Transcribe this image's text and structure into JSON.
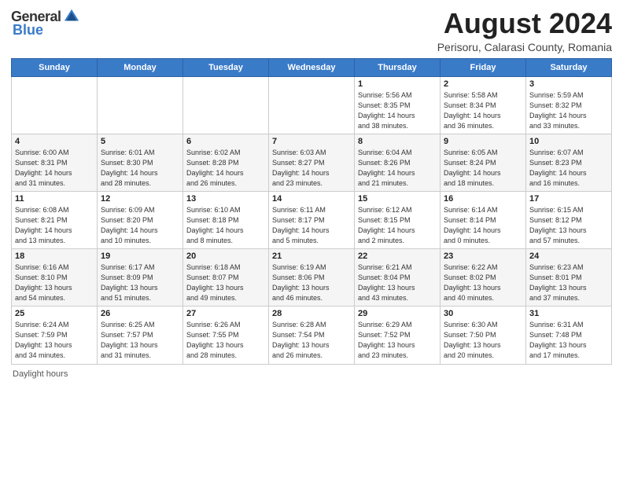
{
  "logo": {
    "general": "General",
    "blue": "Blue"
  },
  "header": {
    "month": "August 2024",
    "location": "Perisoru, Calarasi County, Romania"
  },
  "weekdays": [
    "Sunday",
    "Monday",
    "Tuesday",
    "Wednesday",
    "Thursday",
    "Friday",
    "Saturday"
  ],
  "footer": {
    "label": "Daylight hours"
  },
  "weeks": [
    [
      {
        "day": "",
        "info": ""
      },
      {
        "day": "",
        "info": ""
      },
      {
        "day": "",
        "info": ""
      },
      {
        "day": "",
        "info": ""
      },
      {
        "day": "1",
        "info": "Sunrise: 5:56 AM\nSunset: 8:35 PM\nDaylight: 14 hours\nand 38 minutes."
      },
      {
        "day": "2",
        "info": "Sunrise: 5:58 AM\nSunset: 8:34 PM\nDaylight: 14 hours\nand 36 minutes."
      },
      {
        "day": "3",
        "info": "Sunrise: 5:59 AM\nSunset: 8:32 PM\nDaylight: 14 hours\nand 33 minutes."
      }
    ],
    [
      {
        "day": "4",
        "info": "Sunrise: 6:00 AM\nSunset: 8:31 PM\nDaylight: 14 hours\nand 31 minutes."
      },
      {
        "day": "5",
        "info": "Sunrise: 6:01 AM\nSunset: 8:30 PM\nDaylight: 14 hours\nand 28 minutes."
      },
      {
        "day": "6",
        "info": "Sunrise: 6:02 AM\nSunset: 8:28 PM\nDaylight: 14 hours\nand 26 minutes."
      },
      {
        "day": "7",
        "info": "Sunrise: 6:03 AM\nSunset: 8:27 PM\nDaylight: 14 hours\nand 23 minutes."
      },
      {
        "day": "8",
        "info": "Sunrise: 6:04 AM\nSunset: 8:26 PM\nDaylight: 14 hours\nand 21 minutes."
      },
      {
        "day": "9",
        "info": "Sunrise: 6:05 AM\nSunset: 8:24 PM\nDaylight: 14 hours\nand 18 minutes."
      },
      {
        "day": "10",
        "info": "Sunrise: 6:07 AM\nSunset: 8:23 PM\nDaylight: 14 hours\nand 16 minutes."
      }
    ],
    [
      {
        "day": "11",
        "info": "Sunrise: 6:08 AM\nSunset: 8:21 PM\nDaylight: 14 hours\nand 13 minutes."
      },
      {
        "day": "12",
        "info": "Sunrise: 6:09 AM\nSunset: 8:20 PM\nDaylight: 14 hours\nand 10 minutes."
      },
      {
        "day": "13",
        "info": "Sunrise: 6:10 AM\nSunset: 8:18 PM\nDaylight: 14 hours\nand 8 minutes."
      },
      {
        "day": "14",
        "info": "Sunrise: 6:11 AM\nSunset: 8:17 PM\nDaylight: 14 hours\nand 5 minutes."
      },
      {
        "day": "15",
        "info": "Sunrise: 6:12 AM\nSunset: 8:15 PM\nDaylight: 14 hours\nand 2 minutes."
      },
      {
        "day": "16",
        "info": "Sunrise: 6:14 AM\nSunset: 8:14 PM\nDaylight: 14 hours\nand 0 minutes."
      },
      {
        "day": "17",
        "info": "Sunrise: 6:15 AM\nSunset: 8:12 PM\nDaylight: 13 hours\nand 57 minutes."
      }
    ],
    [
      {
        "day": "18",
        "info": "Sunrise: 6:16 AM\nSunset: 8:10 PM\nDaylight: 13 hours\nand 54 minutes."
      },
      {
        "day": "19",
        "info": "Sunrise: 6:17 AM\nSunset: 8:09 PM\nDaylight: 13 hours\nand 51 minutes."
      },
      {
        "day": "20",
        "info": "Sunrise: 6:18 AM\nSunset: 8:07 PM\nDaylight: 13 hours\nand 49 minutes."
      },
      {
        "day": "21",
        "info": "Sunrise: 6:19 AM\nSunset: 8:06 PM\nDaylight: 13 hours\nand 46 minutes."
      },
      {
        "day": "22",
        "info": "Sunrise: 6:21 AM\nSunset: 8:04 PM\nDaylight: 13 hours\nand 43 minutes."
      },
      {
        "day": "23",
        "info": "Sunrise: 6:22 AM\nSunset: 8:02 PM\nDaylight: 13 hours\nand 40 minutes."
      },
      {
        "day": "24",
        "info": "Sunrise: 6:23 AM\nSunset: 8:01 PM\nDaylight: 13 hours\nand 37 minutes."
      }
    ],
    [
      {
        "day": "25",
        "info": "Sunrise: 6:24 AM\nSunset: 7:59 PM\nDaylight: 13 hours\nand 34 minutes."
      },
      {
        "day": "26",
        "info": "Sunrise: 6:25 AM\nSunset: 7:57 PM\nDaylight: 13 hours\nand 31 minutes."
      },
      {
        "day": "27",
        "info": "Sunrise: 6:26 AM\nSunset: 7:55 PM\nDaylight: 13 hours\nand 28 minutes."
      },
      {
        "day": "28",
        "info": "Sunrise: 6:28 AM\nSunset: 7:54 PM\nDaylight: 13 hours\nand 26 minutes."
      },
      {
        "day": "29",
        "info": "Sunrise: 6:29 AM\nSunset: 7:52 PM\nDaylight: 13 hours\nand 23 minutes."
      },
      {
        "day": "30",
        "info": "Sunrise: 6:30 AM\nSunset: 7:50 PM\nDaylight: 13 hours\nand 20 minutes."
      },
      {
        "day": "31",
        "info": "Sunrise: 6:31 AM\nSunset: 7:48 PM\nDaylight: 13 hours\nand 17 minutes."
      }
    ]
  ]
}
